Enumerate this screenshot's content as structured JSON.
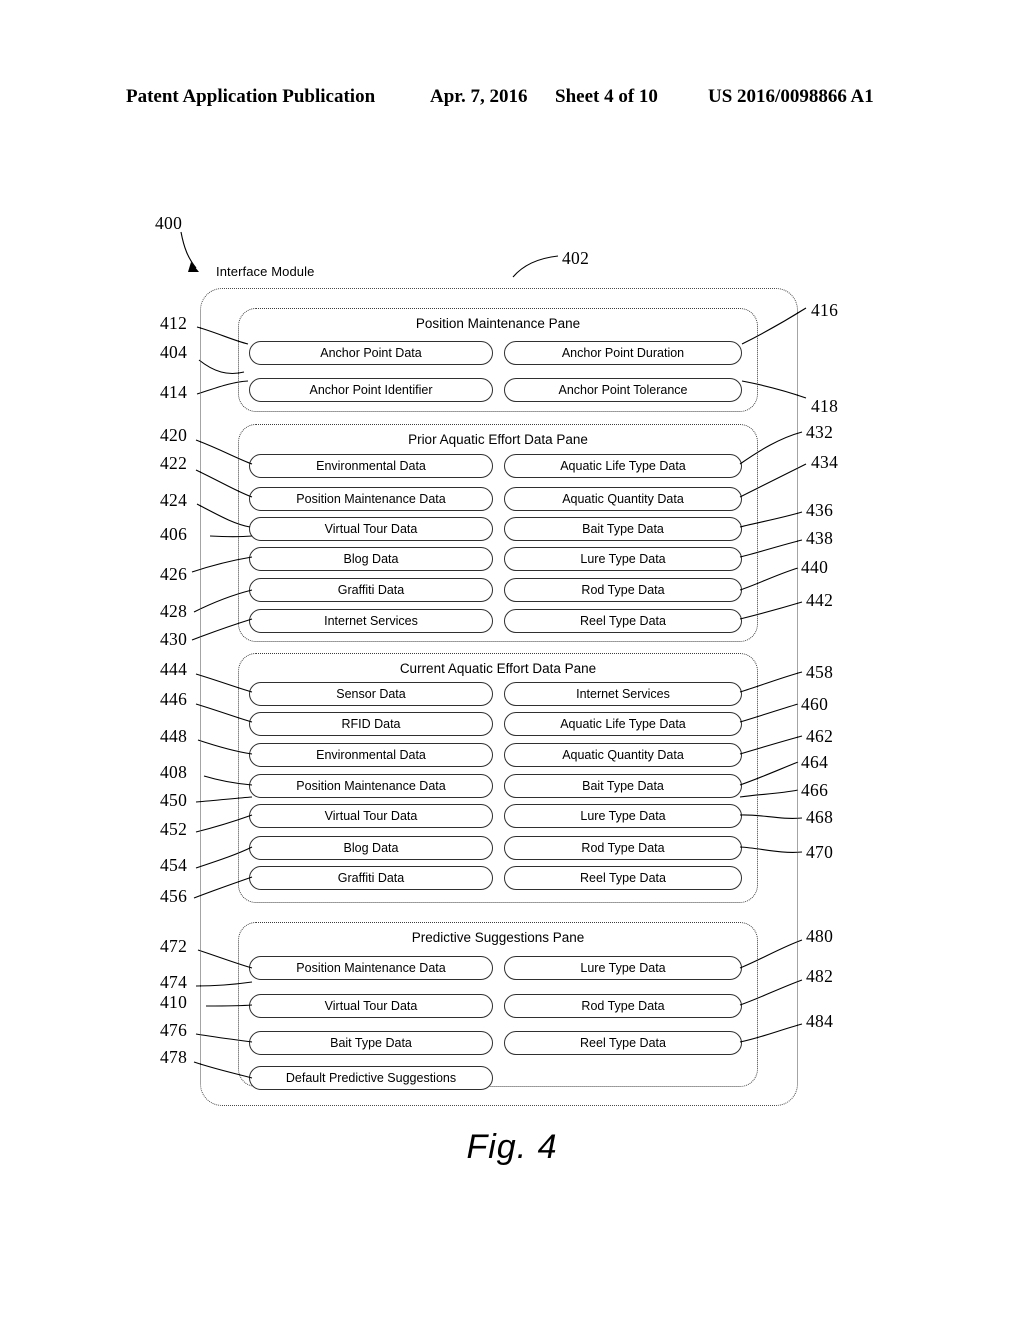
{
  "header": {
    "publication": "Patent Application Publication",
    "date": "Apr. 7, 2016",
    "sheet": "Sheet 4 of 10",
    "number": "US 2016/0098866 A1"
  },
  "figure": {
    "caption": "Fig. 4",
    "diagram_ref": "400",
    "module_label": "Interface Module",
    "module_ref": "402"
  },
  "panes": [
    {
      "title": "Position Maintenance Pane",
      "left_items": [
        {
          "label": "Anchor Point Data",
          "ref": "404"
        },
        {
          "label": "Anchor Point Identifier",
          "ref": "414"
        }
      ],
      "right_items": [
        {
          "label": "Anchor Point Duration",
          "ref": "416"
        },
        {
          "label": "Anchor Point Tolerance",
          "ref": "418"
        }
      ],
      "pane_ref": "412"
    },
    {
      "title": "Prior Aquatic Effort Data Pane",
      "left_items": [
        {
          "label": "Environmental Data",
          "ref": "422"
        },
        {
          "label": "Position Maintenance Data",
          "ref": "424"
        },
        {
          "label": "Virtual Tour Data",
          "ref": "406"
        },
        {
          "label": "Blog Data",
          "ref": "426"
        },
        {
          "label": "Graffiti Data",
          "ref": "428"
        },
        {
          "label": "Internet Services",
          "ref": "430"
        }
      ],
      "right_items": [
        {
          "label": "Aquatic Life Type Data",
          "ref": "432"
        },
        {
          "label": "Aquatic Quantity Data",
          "ref": "434"
        },
        {
          "label": "Bait Type Data",
          "ref": "436"
        },
        {
          "label": "Lure Type Data",
          "ref": "438"
        },
        {
          "label": "Rod Type Data",
          "ref": "440"
        },
        {
          "label": "Reel Type Data",
          "ref": "442"
        }
      ],
      "pane_ref": "420"
    },
    {
      "title": "Current Aquatic Effort Data Pane",
      "left_items": [
        {
          "label": "Sensor Data",
          "ref": "446"
        },
        {
          "label": "RFID Data",
          "ref": "448"
        },
        {
          "label": "Environmental Data",
          "ref": "408"
        },
        {
          "label": "Position Maintenance Data",
          "ref": "450"
        },
        {
          "label": "Virtual Tour Data",
          "ref": "452"
        },
        {
          "label": "Blog Data",
          "ref": "454"
        },
        {
          "label": "Graffiti Data",
          "ref": "456"
        }
      ],
      "right_items": [
        {
          "label": "Internet Services",
          "ref": "458"
        },
        {
          "label": "Aquatic Life Type Data",
          "ref": "460"
        },
        {
          "label": "Aquatic Quantity Data",
          "ref": "462"
        },
        {
          "label": "Bait Type Data",
          "ref": "464"
        },
        {
          "label": "Lure Type Data",
          "ref": "466"
        },
        {
          "label": "Rod Type Data",
          "ref": "468"
        },
        {
          "label": "Reel Type Data",
          "ref": "470"
        }
      ],
      "pane_ref": "444"
    },
    {
      "title": "Predictive Suggestions Pane",
      "left_items": [
        {
          "label": "Position Maintenance Data",
          "ref": "474"
        },
        {
          "label": "Virtual Tour Data",
          "ref": "410"
        },
        {
          "label": "Bait Type Data",
          "ref": "476"
        },
        {
          "label": "Default Predictive Suggestions",
          "ref": "478"
        }
      ],
      "right_items": [
        {
          "label": "Lure Type Data",
          "ref": "480"
        },
        {
          "label": "Rod Type Data",
          "ref": "482"
        },
        {
          "label": "Reel Type Data",
          "ref": "484"
        }
      ],
      "pane_ref": "472"
    }
  ],
  "reference_numerals": {
    "left_column": [
      "412",
      "404",
      "414",
      "420",
      "422",
      "424",
      "406",
      "426",
      "428",
      "430",
      "444",
      "446",
      "448",
      "408",
      "450",
      "452",
      "454",
      "456",
      "472",
      "474",
      "410",
      "476",
      "478"
    ],
    "right_column": [
      "416",
      "418",
      "432",
      "434",
      "436",
      "438",
      "440",
      "442",
      "458",
      "460",
      "462",
      "464",
      "466",
      "468",
      "470",
      "480",
      "482",
      "484"
    ]
  }
}
